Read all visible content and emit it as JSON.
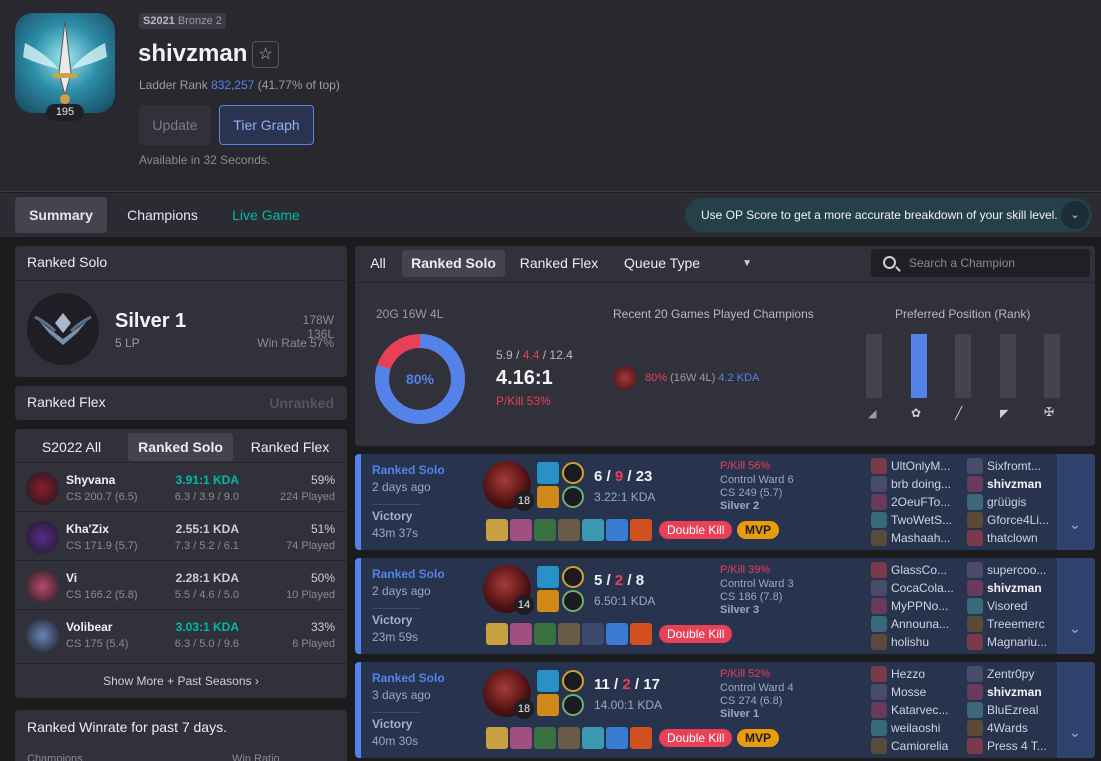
{
  "profile": {
    "level": "195",
    "tier_badge_season": "S2021",
    "tier_badge_rank": "Bronze 2",
    "name": "shivzman",
    "ladder_label": "Ladder Rank",
    "ladder_rank": "832,257",
    "ladder_pct": "(41.77% of top)",
    "update_label": "Update",
    "tier_graph_label": "Tier Graph",
    "available": "Available in 32 Seconds.",
    "star_icon": "star-icon"
  },
  "tabs": {
    "summary": "Summary",
    "champions": "Champions",
    "live": "Live Game"
  },
  "op_banner": "Use OP Score to get a more accurate breakdown of your skill level.",
  "ranked_solo": {
    "title": "Ranked Solo",
    "tier": "Silver 1",
    "lp": "5 LP",
    "wl": "178W 136L",
    "winrate": "Win Rate 57%"
  },
  "ranked_flex": {
    "title": "Ranked Flex",
    "status": "Unranked"
  },
  "season_tabs": [
    "S2022 All",
    "Ranked Solo",
    "Ranked Flex"
  ],
  "champions": [
    {
      "name": "Shyvana",
      "cs": "CS 200.7 (6.5)",
      "kda": "3.91:1 KDA",
      "kda_detail": "6.3 / 3.9 / 9.0",
      "wr": "59%",
      "played": "224 Played",
      "hi": true,
      "color": "#8a1c2a"
    },
    {
      "name": "Kha'Zix",
      "cs": "CS 171.9 (5.7)",
      "kda": "2.55:1 KDA",
      "kda_detail": "7.3 / 5.2 / 6.1",
      "wr": "51%",
      "played": "74 Played",
      "hi": false,
      "color": "#5a2a8a"
    },
    {
      "name": "Vi",
      "cs": "CS 166.2 (5.8)",
      "kda": "2.28:1 KDA",
      "kda_detail": "5.5 / 4.6 / 5.0",
      "wr": "50%",
      "played": "10 Played",
      "hi": false,
      "color": "#b84a6a"
    },
    {
      "name": "Volibear",
      "cs": "CS 175 (5.4)",
      "kda": "3.03:1 KDA",
      "kda_detail": "6.3 / 5.0 / 9.6",
      "wr": "33%",
      "played": "6 Played",
      "hi": true,
      "color": "#6a84b8"
    }
  ],
  "show_more": "Show More + Past Seasons",
  "winrate7": {
    "title": "Ranked Winrate for past 7 days.",
    "col1": "Champions",
    "col2": "Win Ratio"
  },
  "queue_tabs": {
    "all": "All",
    "solo": "Ranked Solo",
    "flex": "Ranked Flex",
    "type": "Queue Type"
  },
  "search_placeholder": "Search a Champion",
  "summary": {
    "record": "20G 16W 4L",
    "donut_pct": "80%",
    "donut_value": 0.8,
    "kda_k": "5.9",
    "kda_d": "4.4",
    "kda_a": "12.4",
    "kda_ratio": "4.16:1",
    "pkill": "P/Kill 53%",
    "recent_title": "Recent 20 Games Played Champions",
    "recent_wr": "80%",
    "recent_record": "(16W 4L)",
    "recent_kda": "4.2 KDA",
    "position_title": "Preferred Position (Rank)",
    "positions": [
      0,
      1,
      0,
      0,
      0
    ]
  },
  "matches": [
    {
      "queue": "Ranked Solo",
      "ago": "2 days ago",
      "result": "Victory",
      "duration": "43m 37s",
      "level": "18",
      "k": "6",
      "d": "9",
      "a": "23",
      "ratio": "3.22:1 KDA",
      "pkill": "P/Kill 56%",
      "ward": "Control Ward 6",
      "cs": "CS 249 (5.7)",
      "rank": "Silver 2",
      "badges": [
        "Double Kill",
        "MVP"
      ],
      "team1": [
        "UltOnlyM...",
        "brb doing...",
        "2OeuFTo...",
        "TwoWetS...",
        "Mashaah..."
      ],
      "team2": [
        "Sixfromt...",
        "shivzman",
        "grüügis",
        "Gforce4Li...",
        "thatclown"
      ]
    },
    {
      "queue": "Ranked Solo",
      "ago": "2 days ago",
      "result": "Victory",
      "duration": "23m 59s",
      "level": "14",
      "k": "5",
      "d": "2",
      "a": "8",
      "ratio": "6.50:1 KDA",
      "pkill": "P/Kill 39%",
      "ward": "Control Ward 3",
      "cs": "CS 186 (7.8)",
      "rank": "Silver 3",
      "badges": [
        "Double Kill"
      ],
      "team1": [
        "GlassCo...",
        "CocaCola...",
        "MyPPNo...",
        "Announa...",
        "holishu"
      ],
      "team2": [
        "supercoo...",
        "shivzman",
        "Visored",
        "Treeemerc",
        "Magnariu..."
      ]
    },
    {
      "queue": "Ranked Solo",
      "ago": "3 days ago",
      "result": "Victory",
      "duration": "40m 30s",
      "level": "18",
      "k": "11",
      "d": "2",
      "a": "17",
      "ratio": "14.00:1 KDA",
      "pkill": "P/Kill 52%",
      "ward": "Control Ward 4",
      "cs": "CS 274 (6.8)",
      "rank": "Silver 1",
      "badges": [
        "Double Kill",
        "MVP"
      ],
      "team1": [
        "Hezzo",
        "Mosse",
        "Katarvec...",
        "weilaoshi",
        "Camiorelia"
      ],
      "team2": [
        "Zentr0py",
        "shivzman",
        "BluEzreal",
        "4Wards",
        "Press 4 T..."
      ]
    }
  ]
}
